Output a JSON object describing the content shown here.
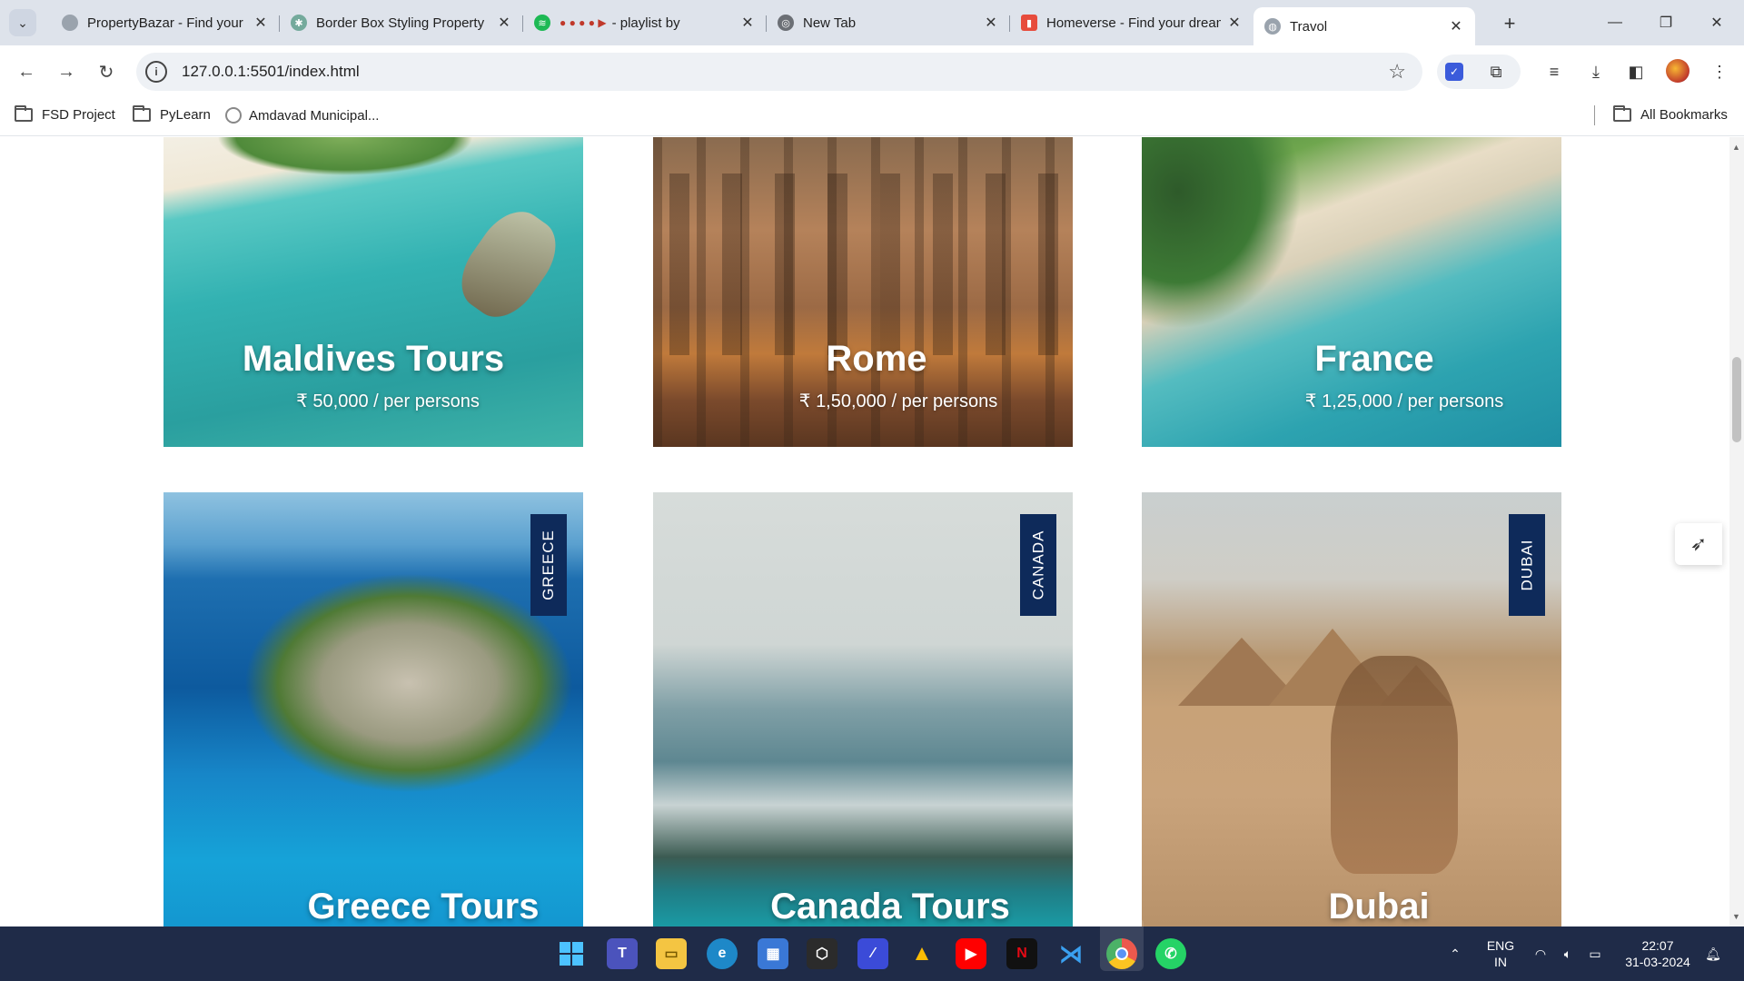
{
  "browser": {
    "tabs": [
      {
        "title": "PropertyBazar - Find your dream",
        "favicon": "circle-grey-icon",
        "active": false
      },
      {
        "title": "Border Box Styling Property",
        "favicon": "chatgpt-icon",
        "active": false
      },
      {
        "title": "- playlist by",
        "favicon": "spotify-icon",
        "active": false
      },
      {
        "title": "New Tab",
        "favicon": "chrome-icon",
        "active": false
      },
      {
        "title": "Homeverse - Find your dream",
        "favicon": "homeverse-icon",
        "active": false
      },
      {
        "title": "Travol",
        "favicon": "globe-icon",
        "active": true
      }
    ],
    "address": "127.0.0.1:5501/index.html",
    "bookmarks": [
      "FSD Project",
      "PyLearn",
      "Amdavad Municipal..."
    ],
    "all_bookmarks": "All Bookmarks"
  },
  "tours": [
    {
      "title": "Maldives Tours",
      "price": "₹ 50,000 / per persons"
    },
    {
      "title": "Rome",
      "price": "₹ 1,50,000 / per persons"
    },
    {
      "title": "France",
      "price": "₹ 1,25,000 / per persons"
    },
    {
      "title": "Greece Tours",
      "badge": "GREECE"
    },
    {
      "title": "Canada Tours",
      "badge": "CANADA"
    },
    {
      "title": "Dubai",
      "badge": "DUBAI"
    }
  ],
  "taskbar": {
    "language": "ENG",
    "region": "IN",
    "time": "22:07",
    "date": "31-03-2024"
  },
  "colors": {
    "badge": "#0e2a5a",
    "taskbar": "#1f2b48",
    "tabstrip": "#dee3eb"
  }
}
